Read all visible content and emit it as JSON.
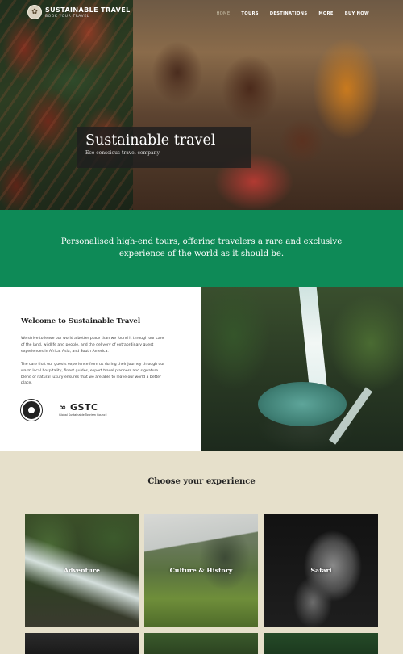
{
  "header": {
    "logo_title": "SUSTAINABLE TRAVEL",
    "logo_sub": "BOOK YOUR TRAVEL",
    "nav": [
      "HOME",
      "TOURS",
      "DESTINATIONS",
      "MORE",
      "BUY NOW"
    ]
  },
  "hero": {
    "title": "Sustainable travel",
    "subtitle": "Eco conscious travel company"
  },
  "band": {
    "text": "Personalised high-end tours, offering travelers a rare and exclusive experience of the world as it should be."
  },
  "welcome": {
    "title": "Welcome to Sustainable Travel",
    "p1": "We strive to leave our world a better place than we found it through our care of the land, wildlife and people, and the delivery of extraordinary guest experiences in Africa, Asia, and South America.",
    "p2": "The care that our guests experience from us during their journey through our warm local hospitality, finest guides, expert travel planners and signature blend of natural luxury ensures that we are able to leave our world a better place.",
    "gstc_mark": "∞ GSTC",
    "gstc_sub": "Global Sustainable Tourism Council"
  },
  "experiences": {
    "title": "Choose your experience",
    "cards": [
      "Adventure",
      "Culture & History",
      "Safari"
    ]
  }
}
